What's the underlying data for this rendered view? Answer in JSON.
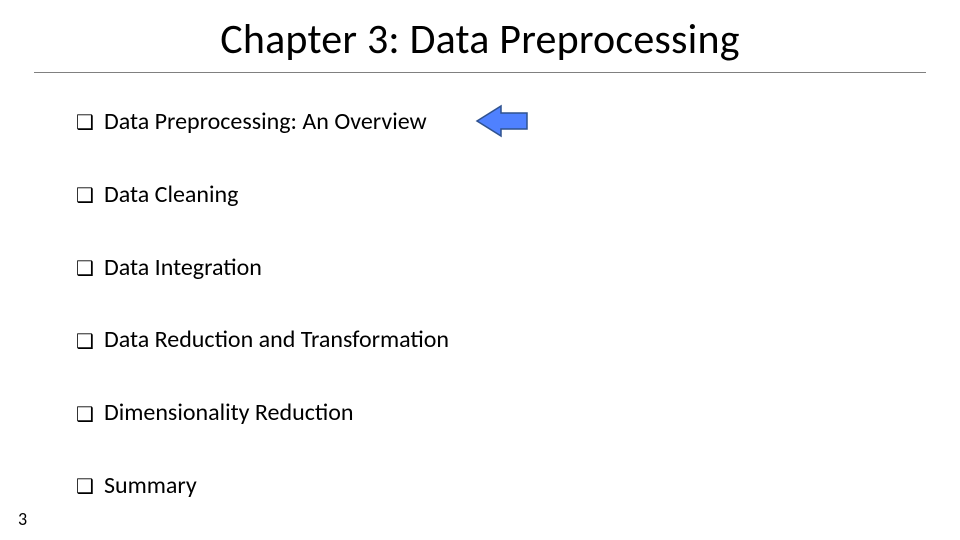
{
  "title": "Chapter 3: Data Preprocessing",
  "bullets": [
    {
      "label": "Data Preprocessing: An Overview"
    },
    {
      "label": "Data Cleaning"
    },
    {
      "label": "Data Integration"
    },
    {
      "label": "Data Reduction and Transformation"
    },
    {
      "label": "Dimensionality Reduction"
    },
    {
      "label": "Summary"
    }
  ],
  "bullet_marker": "❑",
  "page_number": "3",
  "arrow": {
    "fill": "#4F81FF",
    "stroke": "#2F528F"
  }
}
